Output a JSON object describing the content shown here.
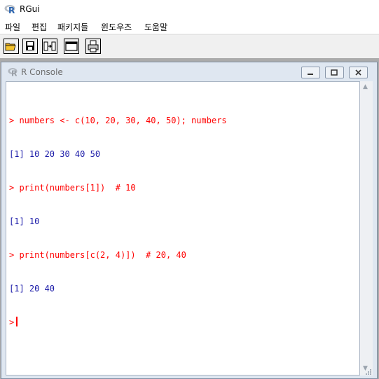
{
  "app": {
    "title": "RGui"
  },
  "menu": [
    "파일",
    "편집",
    "패키지들",
    "윈도우즈",
    "도움말"
  ],
  "toolbar": {
    "buttons": [
      "open-script",
      "save-workspace",
      "copy-paste",
      "console",
      "print"
    ]
  },
  "console": {
    "title": "R Console",
    "lines": [
      {
        "type": "cmd",
        "text": "> numbers <- c(10, 20, 30, 40, 50); numbers"
      },
      {
        "type": "out",
        "text": "[1] 10 20 30 40 50"
      },
      {
        "type": "cmd",
        "text": "> print(numbers[1])  # 10"
      },
      {
        "type": "out",
        "text": "[1] 10"
      },
      {
        "type": "cmd",
        "text": "> print(numbers[c(2, 4)])  # 20, 40"
      },
      {
        "type": "out",
        "text": "[1] 20 40"
      }
    ],
    "prompt": ">"
  },
  "colors": {
    "command": "#ff0000",
    "output": "#1a1aa8",
    "mdi_background": "#ababab"
  }
}
